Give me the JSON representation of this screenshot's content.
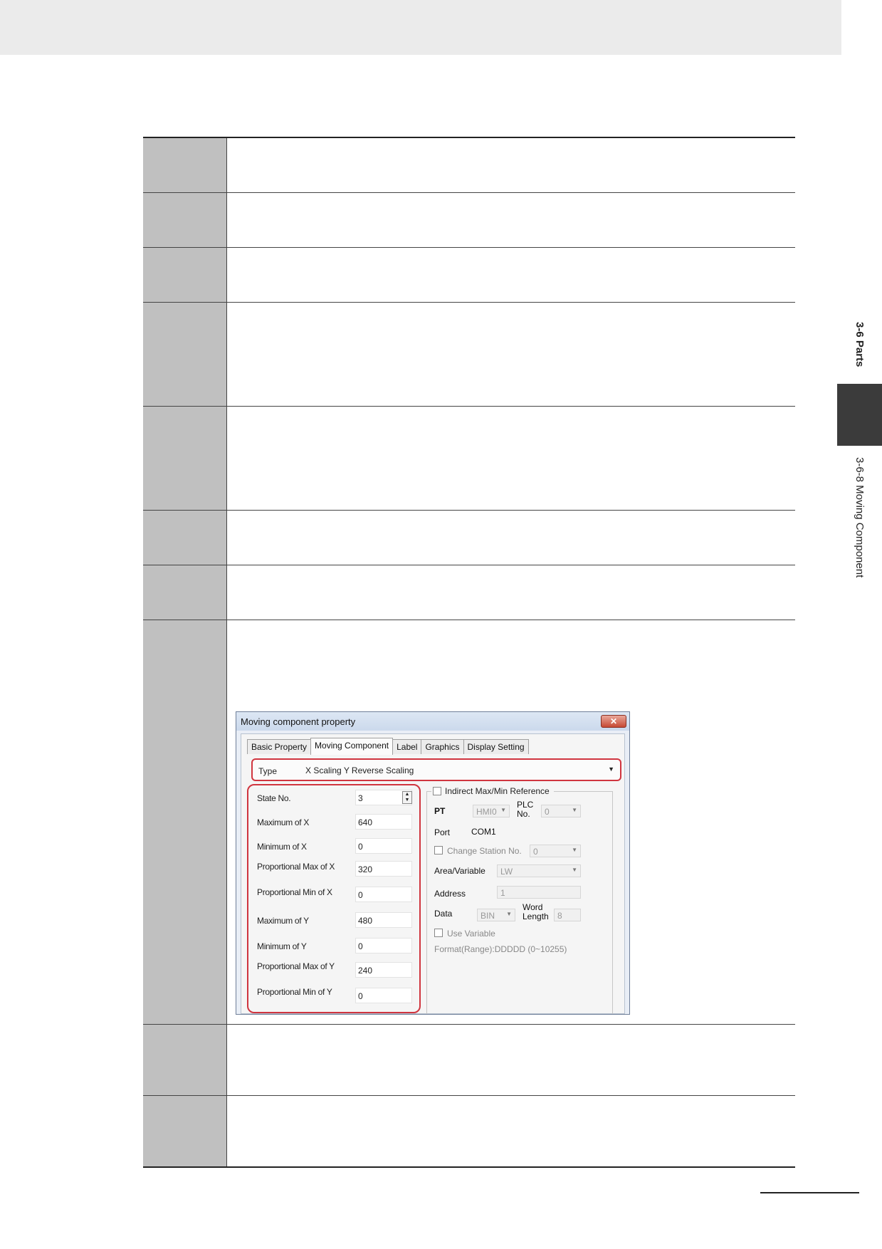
{
  "side": {
    "section": "3-6 Parts",
    "subsection": "3-6-8 Moving Component"
  },
  "dialog": {
    "title": "Moving component property",
    "close_glyph": "✕",
    "tabs": [
      "Basic Property",
      "Moving Component",
      "Label",
      "Graphics",
      "Display Setting"
    ],
    "type_label": "Type",
    "type_value": "X Scaling Y Reverse Scaling",
    "fields": [
      {
        "label": "State No.",
        "value": "3"
      },
      {
        "label": "Maximum of X",
        "value": "640"
      },
      {
        "label": "Minimum of X",
        "value": "0"
      },
      {
        "label": "Proportional Max of X",
        "value": "320"
      },
      {
        "label": "Proportional Min of X",
        "value": "0"
      },
      {
        "label": "Maximum of Y",
        "value": "480"
      },
      {
        "label": "Minimum of Y",
        "value": "0"
      },
      {
        "label": "Proportional Max of Y",
        "value": "240"
      },
      {
        "label": "Proportional Min of Y",
        "value": "0"
      }
    ],
    "indirect": {
      "label": "Indirect Max/Min Reference",
      "pt_label": "PT",
      "pt_value": "HMI0",
      "plc_label": "PLC No.",
      "plc_value": "0",
      "port_label": "Port",
      "port_value": "COM1",
      "change_station_label": "Change Station No.",
      "change_station_value": "0",
      "area_label": "Area/Variable",
      "area_value": "LW",
      "address_label": "Address",
      "address_value": "1",
      "data_label": "Data",
      "data_value": "BIN",
      "word_length_label": "Word Length",
      "word_length_value": "8",
      "use_variable_label": "Use Variable",
      "format_text": "Format(Range):DDDDD (0~10255)"
    }
  }
}
